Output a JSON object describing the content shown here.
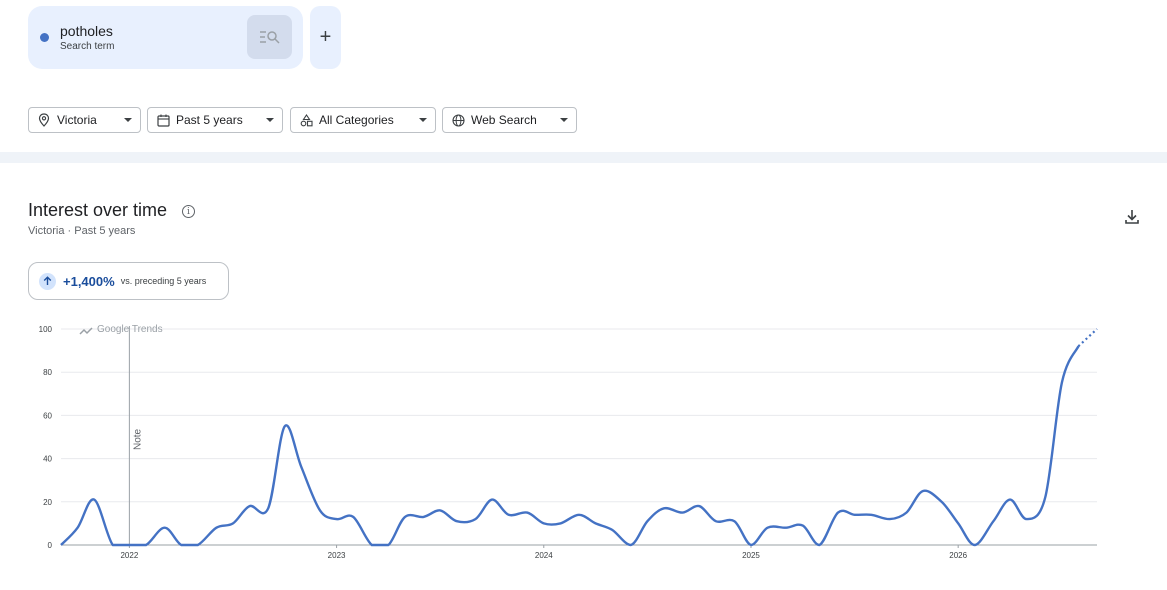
{
  "search_term": {
    "name": "potholes",
    "type_label": "Search term",
    "color": "#4472c4"
  },
  "add_button": {
    "label": "+"
  },
  "filters": {
    "location": "Victoria",
    "time_range": "Past 5 years",
    "category": "All Categories",
    "property": "Web Search"
  },
  "section": {
    "title": "Interest over time",
    "subtitle": "Victoria · Past 5 years",
    "info_icon": "info-icon",
    "download_icon": "download-icon"
  },
  "change": {
    "value": "+1,400%",
    "label": "vs. preceding 5 years"
  },
  "chart_data": {
    "type": "line",
    "watermark": "Google Trends",
    "note_label": "Note",
    "note_x": 2022.0,
    "xlim": [
      2021.67,
      2026.67
    ],
    "ylim": [
      0,
      100
    ],
    "y_ticks": [
      0,
      20,
      40,
      60,
      80,
      100
    ],
    "x_ticks": [
      {
        "value": 2022.0,
        "label": "2022"
      },
      {
        "value": 2023.0,
        "label": "2023"
      },
      {
        "value": 2024.0,
        "label": "2024"
      },
      {
        "value": 2025.0,
        "label": "2025"
      },
      {
        "value": 2026.0,
        "label": "2026"
      }
    ],
    "grid": true,
    "series": [
      {
        "color": "#4472c4",
        "x": [
          2021.67,
          2021.75,
          2021.83,
          2021.92,
          2022.0,
          2022.08,
          2022.17,
          2022.25,
          2022.33,
          2022.42,
          2022.5,
          2022.58,
          2022.67,
          2022.75,
          2022.83,
          2022.92,
          2023.0,
          2023.08,
          2023.17,
          2023.25,
          2023.33,
          2023.42,
          2023.5,
          2023.58,
          2023.67,
          2023.75,
          2023.83,
          2023.92,
          2024.0,
          2024.08,
          2024.17,
          2024.25,
          2024.33,
          2024.42,
          2024.5,
          2024.58,
          2024.67,
          2024.75,
          2024.83,
          2024.92,
          2025.0,
          2025.08,
          2025.17,
          2025.25,
          2025.33,
          2025.42,
          2025.5,
          2025.58,
          2025.67,
          2025.75,
          2025.83,
          2025.92,
          2026.0,
          2026.08,
          2026.17,
          2026.25,
          2026.33,
          2026.42,
          2026.5,
          2026.58
        ],
        "y": [
          0,
          8,
          21,
          0,
          0,
          0,
          8,
          0,
          0,
          8,
          10,
          18,
          17,
          55,
          36,
          16,
          12,
          13,
          0,
          0,
          13,
          13,
          16,
          11,
          12,
          21,
          14,
          15,
          10,
          10,
          14,
          10,
          7,
          0,
          11,
          17,
          15,
          18,
          11,
          11,
          0,
          8,
          8,
          9,
          0,
          15,
          14,
          14,
          12,
          15,
          25,
          20,
          10,
          0,
          11,
          21,
          12,
          22,
          75,
          92
        ]
      }
    ],
    "partial_segment": {
      "x": [
        2026.58,
        2026.67
      ],
      "y": [
        92,
        100
      ]
    }
  }
}
